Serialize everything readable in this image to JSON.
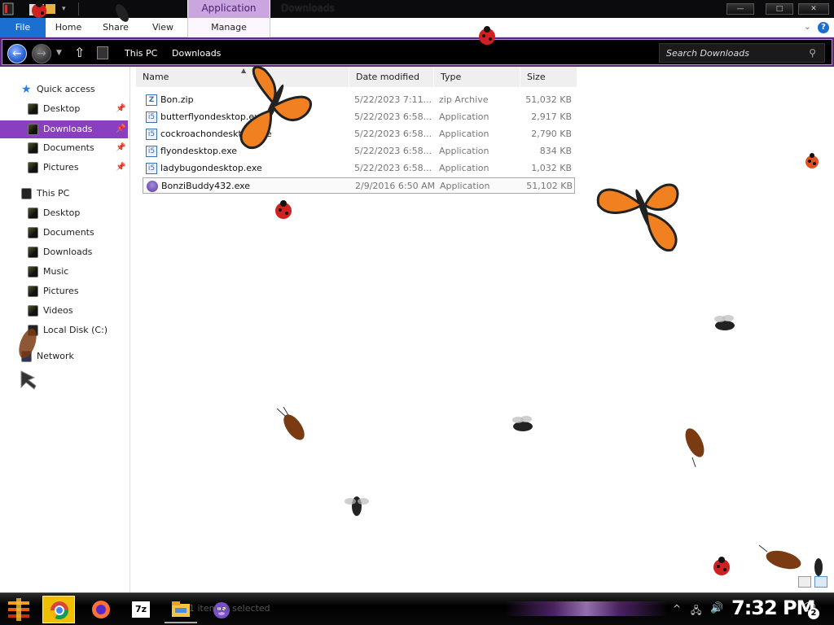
{
  "window": {
    "title": "Downloads",
    "context_tab": "Application Tools",
    "controls": {
      "minimize": "—",
      "maximize": "□",
      "close": "✕"
    }
  },
  "ribbon": {
    "tabs": [
      "File",
      "Home",
      "Share",
      "View",
      "Manage"
    ],
    "help": "?"
  },
  "address": {
    "crumbs": [
      "This PC",
      "Downloads"
    ],
    "search_placeholder": "Search Downloads"
  },
  "nav": {
    "quick_access": "Quick access",
    "quick_items": [
      "Desktop",
      "Downloads",
      "Documents",
      "Pictures"
    ],
    "this_pc": "This PC",
    "pc_items": [
      "Desktop",
      "Documents",
      "Downloads",
      "Music",
      "Pictures",
      "Videos",
      "Local Disk (C:)"
    ],
    "network": "Network",
    "selected": "Downloads"
  },
  "columns": [
    "Name",
    "Date modified",
    "Type",
    "Size"
  ],
  "files": [
    {
      "name": "Bon.zip",
      "date": "5/22/2023 7:11...",
      "type": "zip Archive",
      "size": "51,032 KB",
      "icon": "zip-icon"
    },
    {
      "name": "butterflyondesktop.exe",
      "date": "5/22/2023 6:58...",
      "type": "Application",
      "size": "2,917 KB",
      "icon": "exe-icon"
    },
    {
      "name": "cockroachondesktop.exe",
      "date": "5/22/2023 6:58...",
      "type": "Application",
      "size": "2,790 KB",
      "icon": "exe-icon"
    },
    {
      "name": "flyondesktop.exe",
      "date": "5/22/2023 6:58...",
      "type": "Application",
      "size": "834 KB",
      "icon": "exe-icon"
    },
    {
      "name": "ladybugondesktop.exe",
      "date": "5/22/2023 6:58...",
      "type": "Application",
      "size": "1,032 KB",
      "icon": "exe-icon"
    },
    {
      "name": "BonziBuddy432.exe",
      "date": "2/9/2016 6:50 AM",
      "type": "Application",
      "size": "51,102 KB",
      "icon": "bonzi-icon"
    }
  ],
  "status": "1 item(s) selected",
  "taskbar": {
    "apps": [
      "chrome-icon",
      "firefox-icon",
      "7zip-icon",
      "explorer-icon",
      "bonzi-icon"
    ],
    "seven_zip_label": "7z",
    "clock": "7:32 PM",
    "notifications": "2"
  },
  "colors": {
    "accent": "#8a3fc0",
    "file_tab": "#1a6fd0",
    "address_border": "#b88ad8",
    "context_tab": "#c9a6e0"
  }
}
